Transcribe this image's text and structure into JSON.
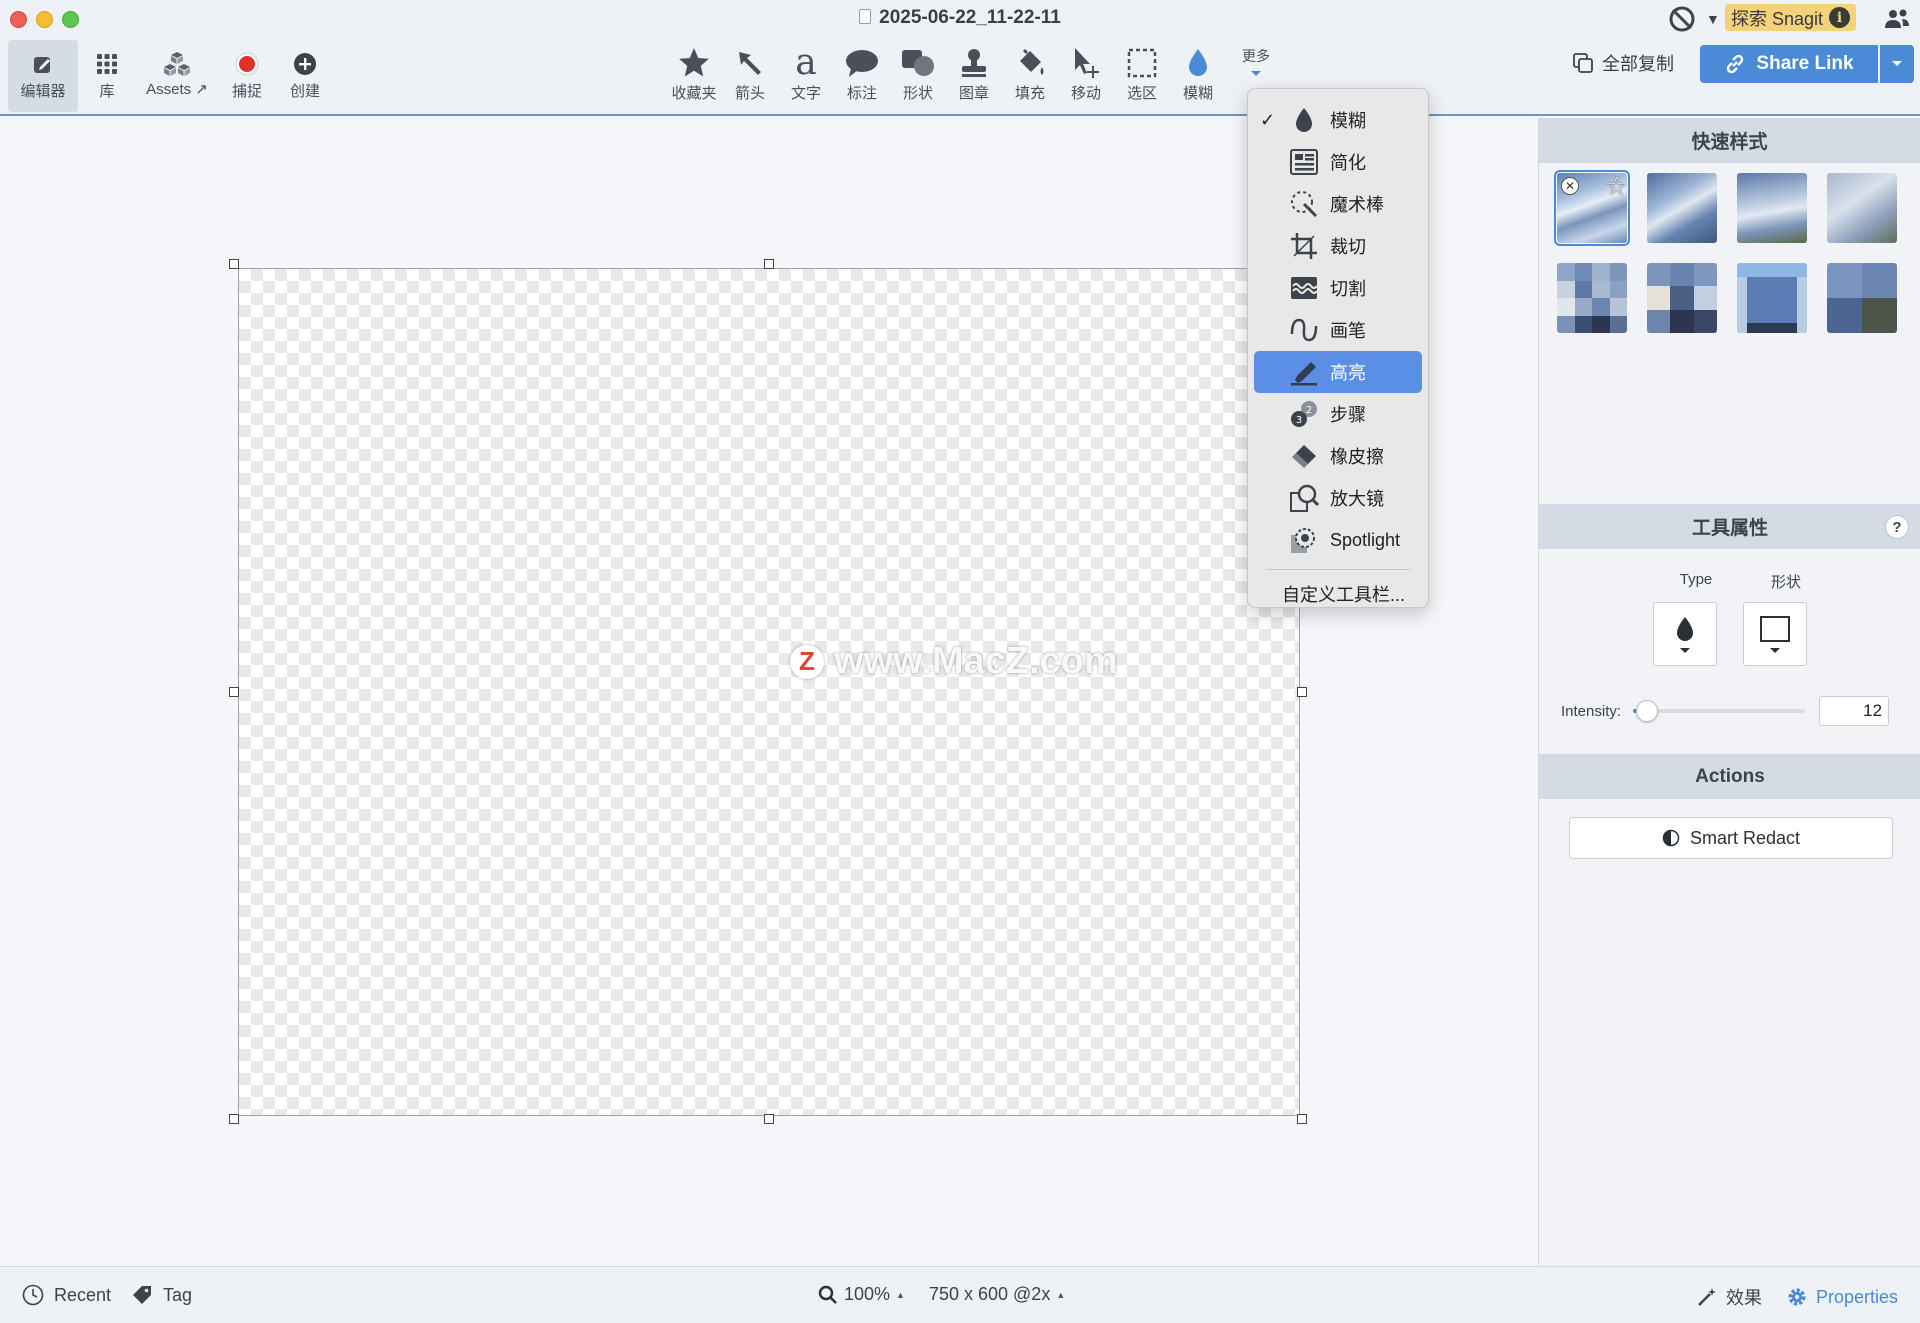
{
  "window": {
    "title": "2025-06-22_11-22-11"
  },
  "left_tools": [
    {
      "label": "编辑器",
      "icon": "edit-icon"
    },
    {
      "label": "库",
      "icon": "grid-icon"
    },
    {
      "label": "Assets ↗",
      "icon": "assets-icon"
    },
    {
      "label": "捕捉",
      "icon": "record-icon"
    },
    {
      "label": "创建",
      "icon": "plus-icon"
    }
  ],
  "center_tools": [
    {
      "label": "收藏夹",
      "icon": "star-icon"
    },
    {
      "label": "箭头",
      "icon": "arrow-icon"
    },
    {
      "label": "文字",
      "icon": "text-icon"
    },
    {
      "label": "标注",
      "icon": "callout-icon"
    },
    {
      "label": "形状",
      "icon": "shape-icon"
    },
    {
      "label": "图章",
      "icon": "stamp-icon"
    },
    {
      "label": "填充",
      "icon": "fill-icon"
    },
    {
      "label": "移动",
      "icon": "move-icon"
    },
    {
      "label": "选区",
      "icon": "selection-icon"
    },
    {
      "label": "模糊",
      "icon": "blur-icon"
    }
  ],
  "more_label": "更多",
  "search_snagit": "探索 Snagit",
  "copy_all": "全部复制",
  "share_link": "Share Link",
  "menu": {
    "items": [
      {
        "label": "模糊",
        "icon": "blur-drop-icon",
        "checked": true
      },
      {
        "label": "简化",
        "icon": "simplify-icon"
      },
      {
        "label": "魔术棒",
        "icon": "magic-wand-icon"
      },
      {
        "label": "裁切",
        "icon": "crop-icon"
      },
      {
        "label": "切割",
        "icon": "cut-out-icon"
      },
      {
        "label": "画笔",
        "icon": "pen-icon"
      },
      {
        "label": "高亮",
        "icon": "highlighter-icon",
        "selected": true
      },
      {
        "label": "步骤",
        "icon": "step-icon"
      },
      {
        "label": "橡皮擦",
        "icon": "eraser-icon"
      },
      {
        "label": "放大镜",
        "icon": "magnifier-icon"
      },
      {
        "label": "Spotlight",
        "icon": "spotlight-icon"
      }
    ],
    "customize": "自定义工具栏...",
    "check_mark": "✓"
  },
  "watermark": {
    "logo": "Z",
    "text": "www.MacZ.com"
  },
  "panel": {
    "quick_styles_title": "快速样式",
    "tool_props_title": "工具属性",
    "help": "?",
    "type_label": "Type",
    "shape_label": "形状",
    "intensity_label": "Intensity:",
    "intensity_value": "12",
    "intensity_fraction": 0.08,
    "actions_title": "Actions",
    "smart_redact": "Smart Redact"
  },
  "status": {
    "recent": "Recent",
    "tag": "Tag",
    "zoom": "100%",
    "dimensions": "750 x 600 @2x",
    "effects": "效果",
    "properties": "Properties"
  },
  "colors": {
    "accent": "#4a8ad6",
    "menu_selected": "#5b8fe6",
    "snagit_badge": "#f3d27a",
    "record": "#e0302a"
  }
}
